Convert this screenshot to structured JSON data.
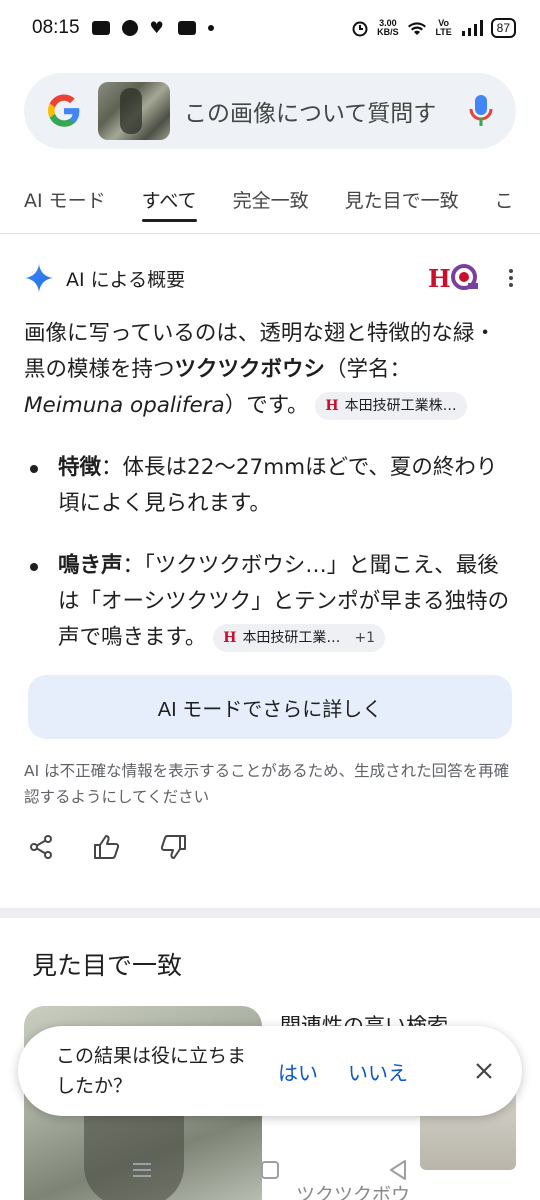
{
  "status_bar": {
    "time": "08:15",
    "net_speed_value": "3.00",
    "net_speed_unit": "KB/S",
    "volte": "Vo LTE",
    "battery": "87"
  },
  "search": {
    "placeholder": "この画像について質問す"
  },
  "tabs": [
    {
      "label": "AI モード"
    },
    {
      "label": "すべて"
    },
    {
      "label": "完全一致"
    },
    {
      "label": "見た目で一致"
    },
    {
      "label": "こ"
    }
  ],
  "ai_overview": {
    "title": "AI による概要",
    "para_start": "画像に写っているのは、透明な翅と特徴的な緑・黒の模様を持つ",
    "para_bold": "ツクツクボウシ",
    "para_mid": "（学名：",
    "para_italic": "Meimuna opalifera",
    "para_end": "）です。",
    "source_chip_1": "本田技研工業株…",
    "bullets": [
      {
        "label": "特徴",
        "text": "：体長は22〜27mmほどで、夏の終わり頃によく見られます。"
      },
      {
        "label": "鳴き声",
        "text": "：「ツクツクボウシ…」と聞こえ、最後は「オーシツクツク」とテンポが早まる独特の声で鳴きます。"
      }
    ],
    "source_chip_2": "本田技研工業…",
    "source_chip_2_extra": "+1",
    "ai_mode_button": "AI モードでさらに詳しく",
    "disclaimer": "AI は不正確な情報を表示することがあるため、生成された回答を再確認するようにしてください"
  },
  "visual_match": {
    "title": "見た目で一致",
    "related_title": "関連性の高い検索",
    "snippet": "ツクツクボウ"
  },
  "feedback": {
    "question": "この結果は役に立ちましたか？",
    "yes": "はい",
    "no": "いいえ"
  },
  "colors": {
    "accent_blue": "#0b57d0",
    "search_bg": "#eef1f6",
    "ai_button_bg": "#e6edfb",
    "brand_red": "#c8102e"
  }
}
